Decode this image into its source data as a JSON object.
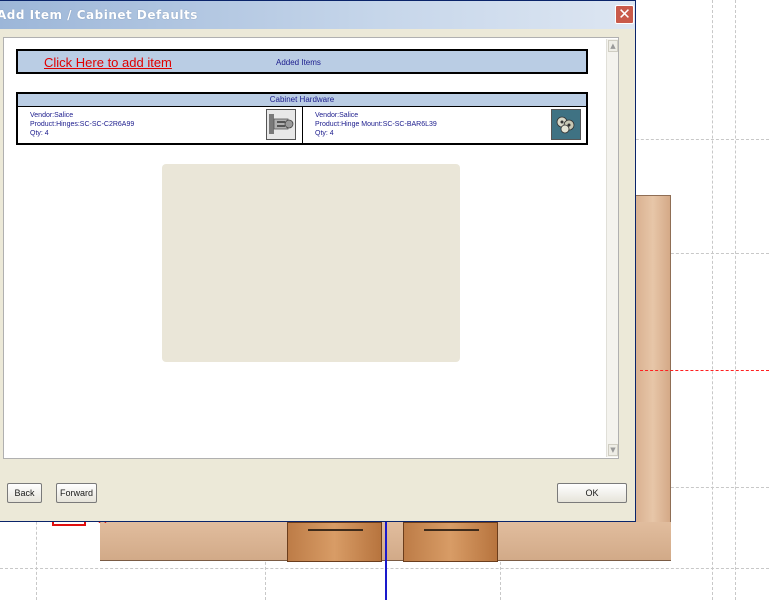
{
  "dialog": {
    "title": "Add Item / Cabinet Defaults",
    "close_glyph": "✕"
  },
  "added_items": {
    "link_text": "Click Here to add item",
    "label": "Added Items"
  },
  "hardware": {
    "header": "Cabinet Hardware",
    "items": [
      {
        "vendor": "Vendor:Salice",
        "product": "Product:Hinges:SC-SC-C2R6A99",
        "qty": "Qty: 4",
        "icon": "hinge-icon"
      },
      {
        "vendor": "Vendor:Salice",
        "product": "Product:Hinge Mount:SC-SC-BAR6L39",
        "qty": "Qty: 4",
        "icon": "hinge-mount-icon"
      }
    ]
  },
  "buttons": {
    "back": "Back",
    "forward": "Forward",
    "ok": "OK"
  },
  "scrollbar": {
    "up_glyph": "▲",
    "down_glyph": "▼"
  },
  "canvas": {
    "marker_glyph": "^"
  },
  "colors": {
    "header_fill": "#bacde4",
    "link_red": "#e00000",
    "text_navy": "#1a1a8c",
    "wood": "#d89c66"
  }
}
